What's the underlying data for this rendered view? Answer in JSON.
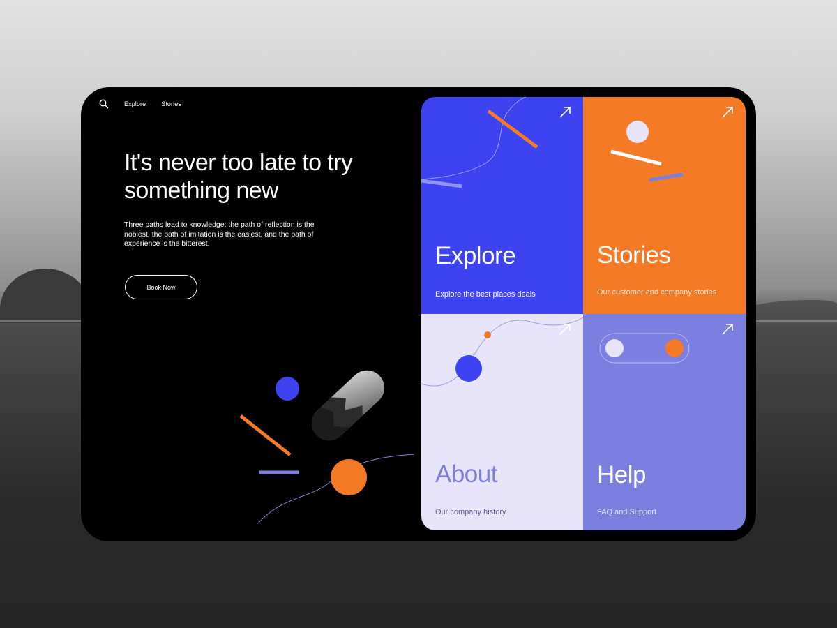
{
  "nav": {
    "explore_label": "Explore",
    "stories_label": "Stories"
  },
  "hero": {
    "headline": "It's never too late to try something new",
    "body": "Three paths lead to knowledge: the path of reflection is the noblest, the path of imitation is the easiest, and the path of experience is the bitterest.",
    "book_label": "Book Now"
  },
  "tiles": [
    {
      "title": "Explore",
      "subtitle": "Explore the best places deals"
    },
    {
      "title": "Stories",
      "subtitle": "Our customer and company stories"
    },
    {
      "title": "About",
      "subtitle": "Our company history"
    },
    {
      "title": "Help",
      "subtitle": "FAQ and Support"
    }
  ],
  "icons": {
    "search": "search-icon",
    "arrow": "arrow-up-right-icon"
  },
  "colors": {
    "blue": "#3d43f0",
    "orange": "#f47a26",
    "lavender": "#e8e4f9",
    "periwinkle": "#7a7fe0",
    "background": "#000000"
  }
}
